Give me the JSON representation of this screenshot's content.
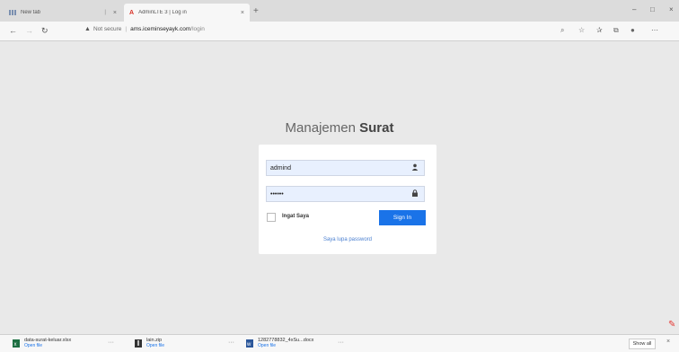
{
  "browser": {
    "tabs": [
      {
        "title": "New tab",
        "active": false
      },
      {
        "title": "AdminLTE 3 | Log in",
        "active": true
      }
    ],
    "new_tab_glyph": "+",
    "window_controls": [
      "–",
      "□",
      "×"
    ],
    "address": {
      "security": "Not secure",
      "host": "ams.iceminseyayk.com",
      "path": "/login"
    }
  },
  "login": {
    "brand_light": "Manajemen",
    "brand_bold": "Surat",
    "username_value": "admind",
    "password_value": "••••••",
    "remember_label": "Ingat Saya",
    "signin_label": "Sign In",
    "forgot_label": "Saya lupa password"
  },
  "downloads": [
    {
      "name": "data-surat-keluar.xlsx",
      "status": "Open file"
    },
    {
      "name": "lain.zip",
      "status": "Open file"
    },
    {
      "name": "1282778832_4xSu...docx",
      "status": "Open file"
    }
  ],
  "show_all_label": "Show all",
  "icons": [
    "back-icon",
    "forward-icon",
    "refresh-icon",
    "warning-icon",
    "search-icon",
    "star-icon",
    "favorites-icon",
    "collections-icon",
    "profile-icon",
    "menu-icon",
    "user-icon",
    "lock-icon",
    "pen-icon"
  ],
  "colors": {
    "accent": "#1a73e8",
    "autofill": "#e8f0fe",
    "page_bg": "#e9e9e9"
  }
}
